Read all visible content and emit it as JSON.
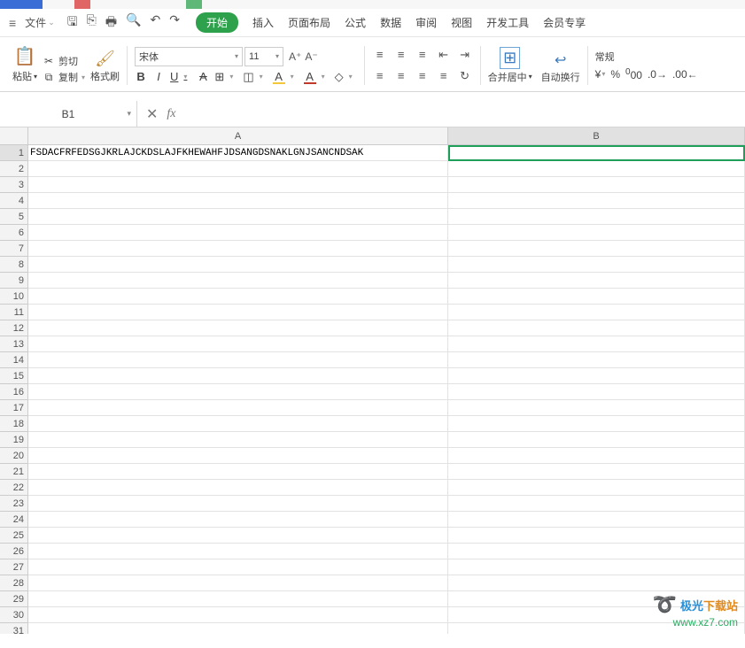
{
  "menu": {
    "file": "文件",
    "tabs": {
      "start": "开始",
      "insert": "插入",
      "layout": "页面布局",
      "formula": "公式",
      "data": "数据",
      "review": "审阅",
      "view": "视图",
      "dev": "开发工具",
      "member": "会员专享"
    }
  },
  "ribbon": {
    "paste": "粘贴",
    "cut": "剪切",
    "copy": "复制",
    "format_painter": "格式刷",
    "font_name": "宋体",
    "font_size": "11",
    "merge_center": "合并居中",
    "wrap_text": "自动换行",
    "number_format": "常规"
  },
  "namebox": "B1",
  "cells": {
    "A1": "FSDACFRFEDSGJKRLAJCKDSLAJFKHEWAHFJDSANGDSNAKLGNJSANCNDSAK"
  },
  "columns": {
    "A": "A",
    "B": "B"
  },
  "watermark": {
    "site_a": "极光",
    "site_b": "下载站",
    "url": "www.xz7.com"
  }
}
